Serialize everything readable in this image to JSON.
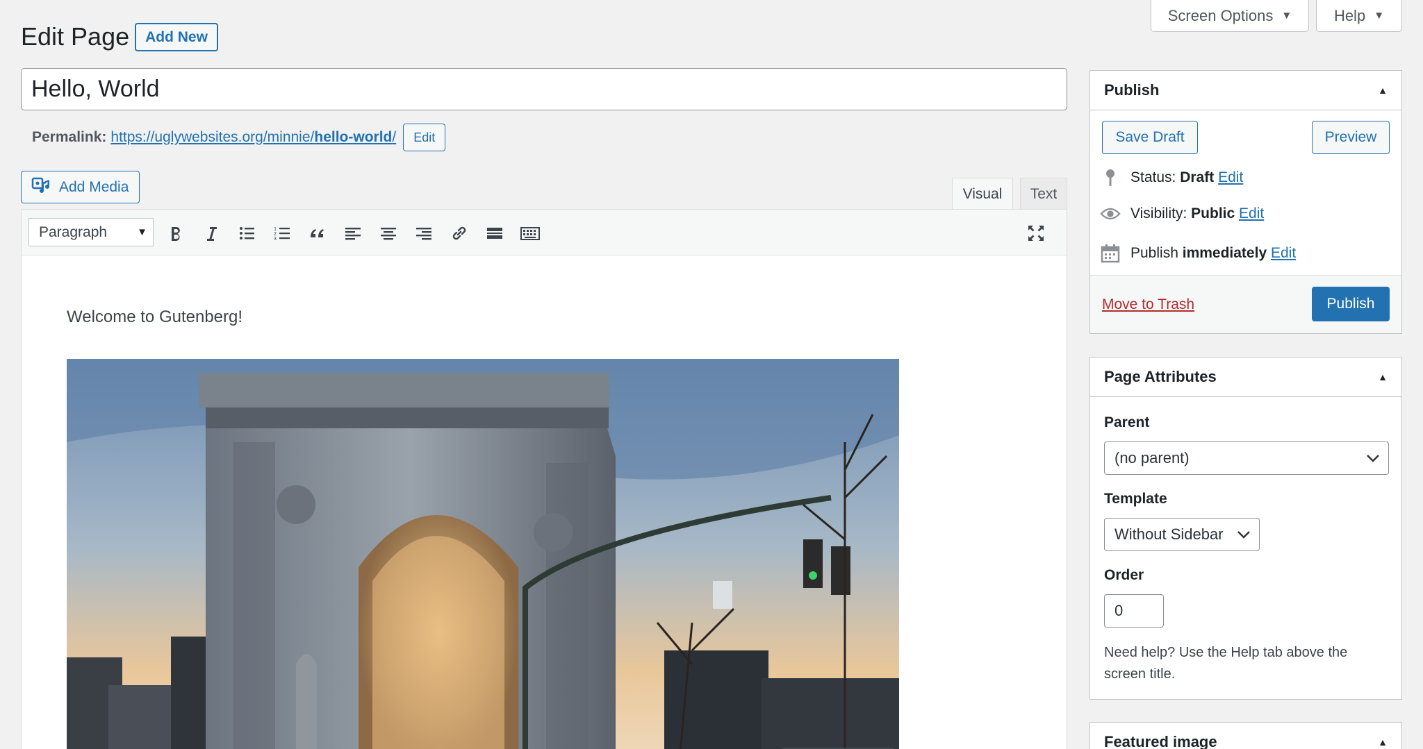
{
  "screen_meta": {
    "screen_options_label": "Screen Options",
    "help_label": "Help"
  },
  "header": {
    "title": "Edit Page",
    "add_new_label": "Add New"
  },
  "post": {
    "title": "Hello, World",
    "permalink_label": "Permalink:",
    "permalink_base": "https://uglywebsites.org/minnie/",
    "permalink_slug": "hello-world",
    "permalink_trailing": "/",
    "permalink_edit_label": "Edit"
  },
  "editor": {
    "add_media_label": "Add Media",
    "tab_visual": "Visual",
    "tab_text": "Text",
    "format_value": "Paragraph",
    "content_text": "Welcome to Gutenberg!"
  },
  "publish_box": {
    "title": "Publish",
    "save_draft_label": "Save Draft",
    "preview_label": "Preview",
    "status_label": "Status:",
    "status_value": "Draft",
    "visibility_label": "Visibility:",
    "visibility_value": "Public",
    "publish_label": "Publish",
    "publish_value": "immediately",
    "edit_label": "Edit",
    "trash_label": "Move to Trash",
    "publish_button_label": "Publish"
  },
  "attributes_box": {
    "title": "Page Attributes",
    "parent_label": "Parent",
    "parent_value": "(no parent)",
    "template_label": "Template",
    "template_value": "Without Sidebar",
    "order_label": "Order",
    "order_value": "0",
    "help_text": "Need help? Use the Help tab above the screen title."
  },
  "featured_box": {
    "title": "Featured image"
  },
  "colors": {
    "accent": "#2271b1",
    "danger": "#b32d2e",
    "background": "#f1f1f1"
  }
}
